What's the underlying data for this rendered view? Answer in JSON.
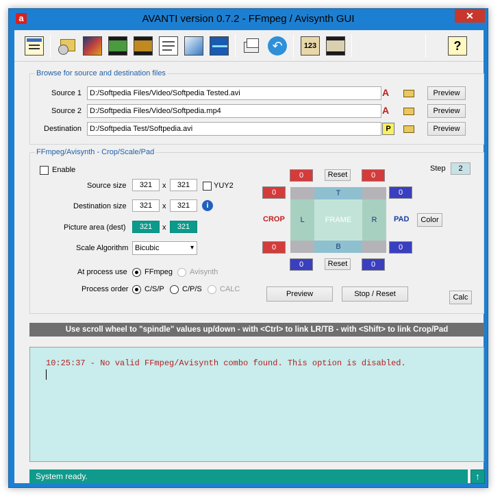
{
  "window": {
    "title": "AVANTI  version  0.7.2  -  FFmpeg / Avisynth GUI",
    "close_glyph": "✕",
    "logo_glyph": "a"
  },
  "toolbar": {
    "buttons": [
      {
        "icon": "window-settings-icon"
      },
      {
        "icon": "disc-folder-icon"
      },
      {
        "icon": "video-edit-icon"
      },
      {
        "icon": "film-strip-icon"
      },
      {
        "icon": "sub-film-icon"
      },
      {
        "icon": "notepad-icon"
      },
      {
        "icon": "script-edit-icon"
      },
      {
        "icon": "audio-wave-icon"
      },
      {
        "icon": "batch-icon"
      },
      {
        "icon": "undo-icon"
      },
      {
        "icon": "numbers-icon"
      },
      {
        "icon": "film-user-icon"
      },
      {
        "icon": "help-icon"
      }
    ]
  },
  "browse": {
    "title": "Browse for source and destination files",
    "rows": [
      {
        "label": "Source 1",
        "value": "D:/Softpedia Files/Video/Softpedia Tested.avi",
        "flag": "A",
        "preview": "Preview"
      },
      {
        "label": "Source 2",
        "value": "D:/Softpedia Files/Video/Softpedia.mp4",
        "flag": "A",
        "preview": "Preview"
      },
      {
        "label": "Destination",
        "value": "D:/Softpedia Test/Softpedia.avi",
        "flag": "P",
        "preview": "Preview"
      }
    ]
  },
  "csp": {
    "title": "FFmpeg/Avisynth - Crop/Scale/Pad",
    "enable_label": "Enable",
    "source_size_label": "Source size",
    "source_w": "321",
    "source_h": "321",
    "x": "x",
    "yuy2_label": "YUY2",
    "dest_size_label": "Destination size",
    "dest_w": "321",
    "dest_h": "321",
    "info_glyph": "i",
    "picture_area_label": "Picture area (dest)",
    "pic_w": "321",
    "pic_h": "321",
    "scale_alg_label": "Scale Algorithm",
    "scale_alg_value": "Bicubic",
    "process_use_label": "At process use",
    "ffmpeg_label": "FFmpeg",
    "avisynth_label": "Avisynth",
    "process_order_label": "Process order",
    "csp_label": "C/S/P",
    "cps_label": "C/P/S",
    "calc_label": "CALC",
    "step_label": "Step",
    "step_value": "2",
    "crop_label": "CROP",
    "pad_label": "PAD",
    "color_button": "Color",
    "reset_top": "Reset",
    "reset_bottom": "Reset",
    "crop_top": "0",
    "pad_top": "0",
    "crop_left": "0",
    "pad_right_top": "0",
    "crop_left_bottom": "0",
    "pad_right_bottom": "0",
    "crop_bottom": "0",
    "pad_bottom": "0",
    "frame_T": "T",
    "frame_L": "L",
    "frame_R": "R",
    "frame_B": "B",
    "frame_label": "FRAME",
    "preview_button": "Preview",
    "stop_reset_button": "Stop / Reset",
    "calc_button": "Calc"
  },
  "hint": "Use scroll wheel to \"spindle\" values up/down  -  with <Ctrl> to link LR/TB  -  with <Shift> to link Crop/Pad",
  "log": {
    "line": "10:25:37 - No valid FFmpeg/Avisynth combo found. This option is disabled."
  },
  "status": {
    "text": "System ready.",
    "up_glyph": "↑"
  }
}
